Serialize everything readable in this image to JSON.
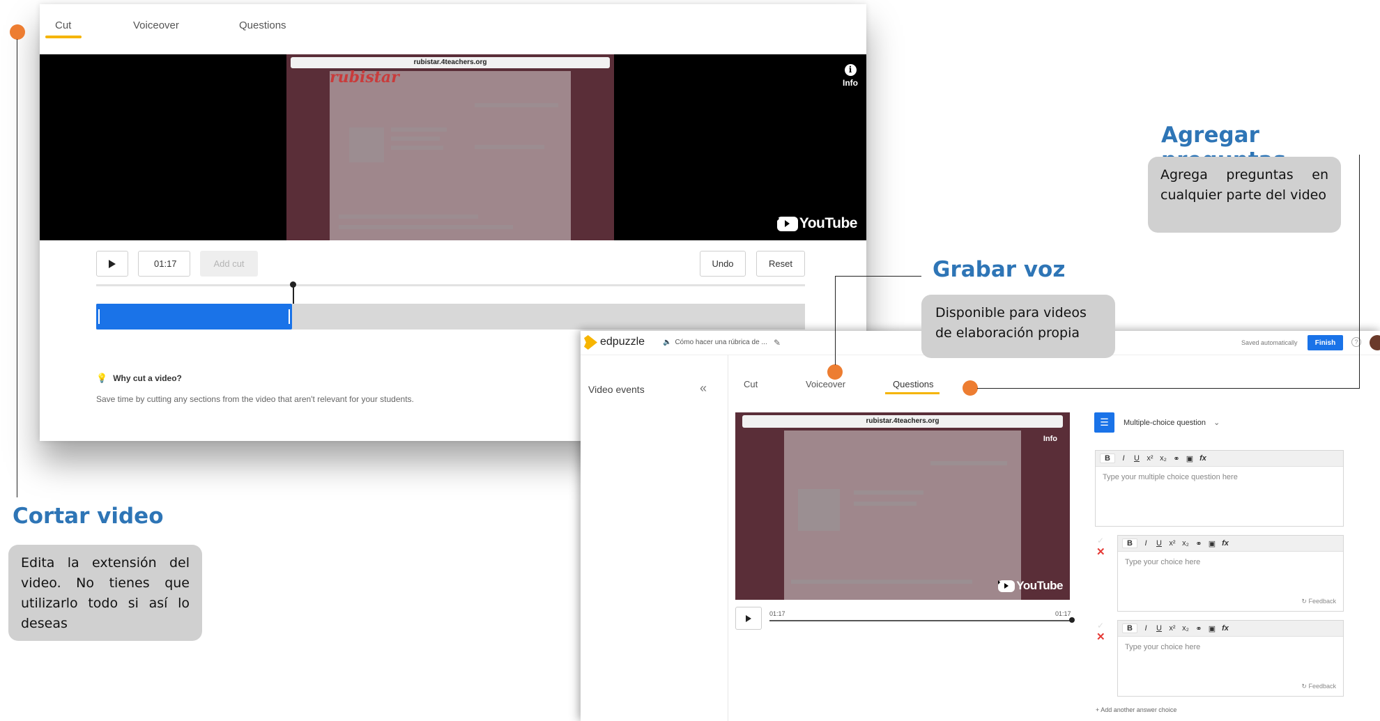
{
  "cut_editor": {
    "tabs": [
      "Cut",
      "Voiceover",
      "Questions"
    ],
    "active_tab": "Cut",
    "video": {
      "browser_url": "rubistar.4teachers.org",
      "site_logo": "rubistar",
      "info_label": "Info",
      "youtube_label": "YouTube"
    },
    "controls": {
      "time_value": "01:17",
      "add_cut_label": "Add cut",
      "undo_label": "Undo",
      "reset_label": "Reset"
    },
    "cut_selection_fraction": 0.276,
    "help": {
      "title": "Why cut a video?",
      "text": "Save time by cutting any sections from the video that aren't relevant for your students."
    }
  },
  "questions_editor": {
    "brand": "edpuzzle",
    "video_title": "Cómo hacer una rúbrica de ...",
    "saved_status": "Saved automatically",
    "finish_label": "Finish",
    "sidebar_title": "Video events",
    "tabs": [
      "Cut",
      "Voiceover",
      "Questions"
    ],
    "active_tab": "Questions",
    "video": {
      "browser_url": "rubistar.4teachers.org",
      "info_label": "Info",
      "youtube_label": "YouTube",
      "time_start": "01:17",
      "time_end": "01:17",
      "progress_fraction": 1.0
    },
    "question_type": "Multiple-choice question",
    "toolbar": [
      "B",
      "I",
      "U",
      "x²",
      "x₂",
      "⚭",
      "▣",
      "fx"
    ],
    "question_placeholder": "Type your multiple choice question here",
    "choices": [
      {
        "placeholder": "Type your choice here",
        "feedback_label": "Feedback"
      },
      {
        "placeholder": "Type your choice here",
        "feedback_label": "Feedback"
      }
    ],
    "add_choice_label": "+ Add another answer choice"
  },
  "annotations": {
    "cut": {
      "title": "Cortar video",
      "text": "Edita la extensión del video. No tienes que utilizarlo todo si así lo deseas"
    },
    "voice": {
      "title": "Grabar voz",
      "text": "Disponible para videos de elaboración propia"
    },
    "questions": {
      "title": "Agregar preguntas",
      "text": "Agrega preguntas en cualquier parte del video"
    },
    "accent_color": "#ed7d31",
    "title_color": "#2e75b6"
  }
}
